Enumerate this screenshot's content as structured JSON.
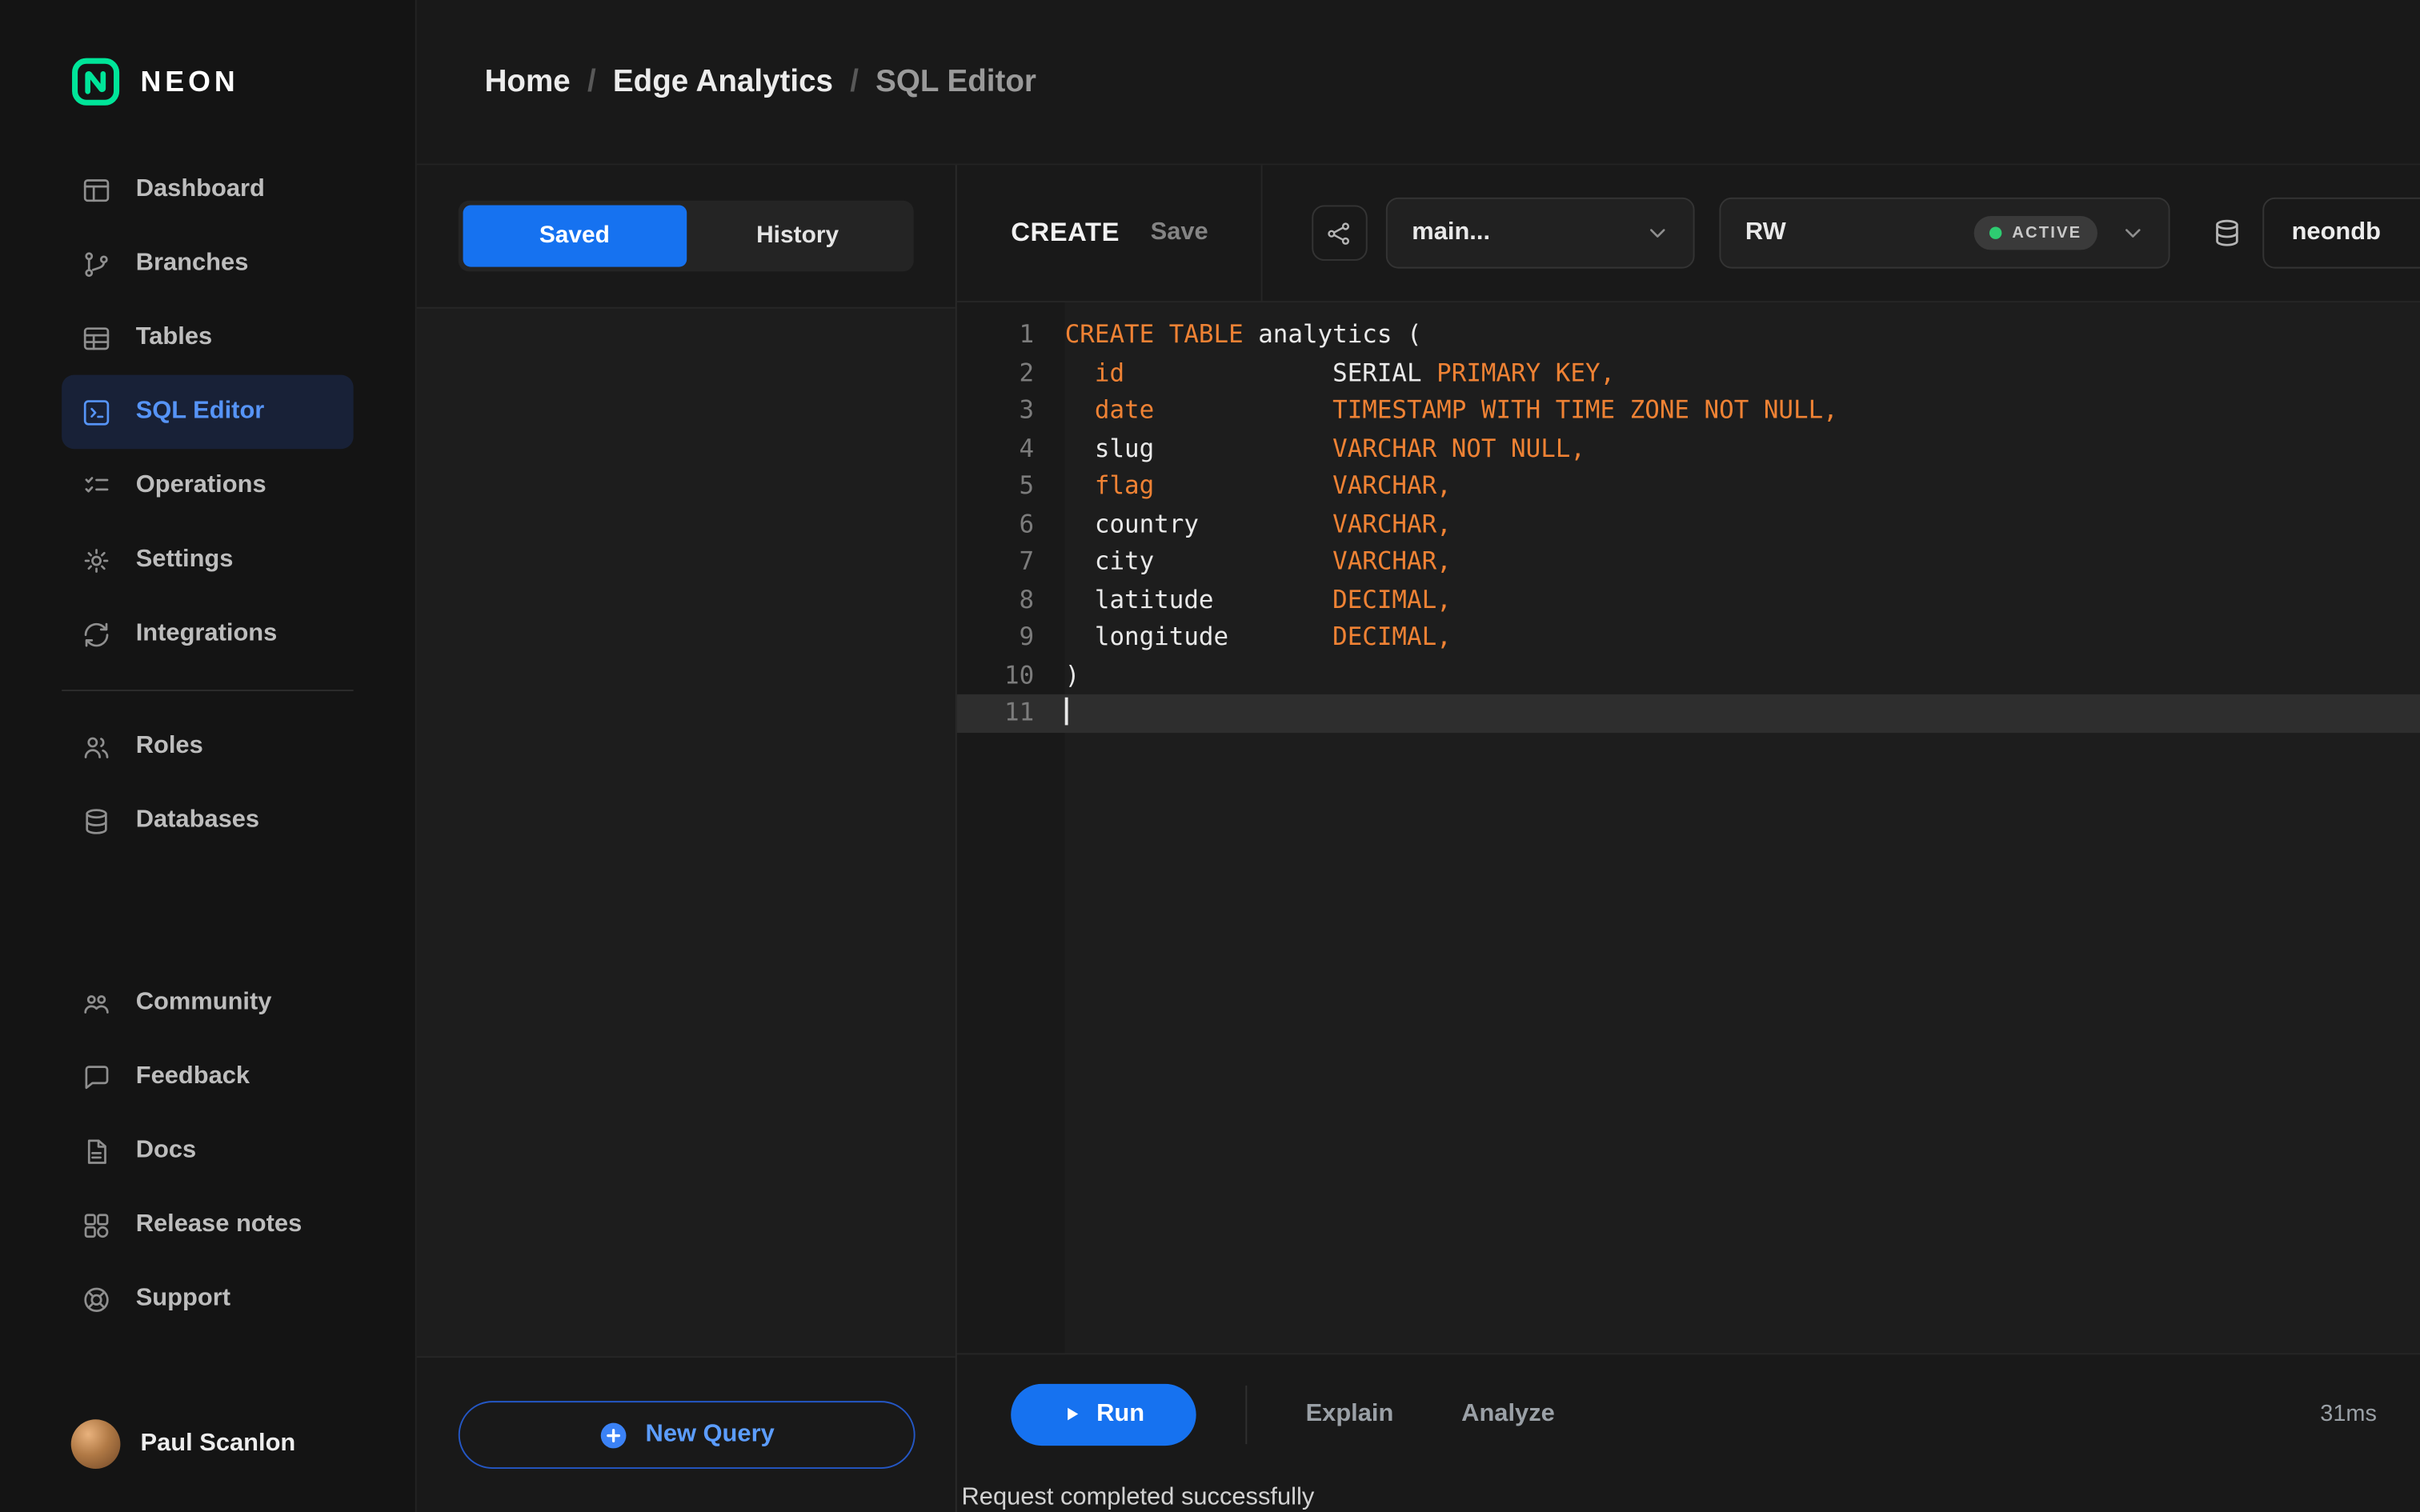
{
  "brand": {
    "name": "NEON"
  },
  "colors": {
    "accent_blue": "#1672f0",
    "accent_text": "#5694f7",
    "link_blue": "#5c9dff",
    "keyword_orange": "#ef8234",
    "neon_green": "#00e599",
    "status_green": "#2ecc71"
  },
  "breadcrumb": {
    "separator": "/",
    "items": [
      "Home",
      "Edge Analytics",
      "SQL Editor"
    ]
  },
  "sidebar": {
    "sections": [
      {
        "items": [
          {
            "icon": "dashboard-icon",
            "label": "Dashboard"
          },
          {
            "icon": "branches-icon",
            "label": "Branches"
          },
          {
            "icon": "tables-icon",
            "label": "Tables"
          },
          {
            "icon": "sql-editor-icon",
            "label": "SQL Editor",
            "active": true
          },
          {
            "icon": "operations-icon",
            "label": "Operations"
          },
          {
            "icon": "settings-icon",
            "label": "Settings"
          },
          {
            "icon": "integrations-icon",
            "label": "Integrations"
          }
        ]
      },
      {
        "items": [
          {
            "icon": "roles-icon",
            "label": "Roles"
          },
          {
            "icon": "databases-icon",
            "label": "Databases"
          }
        ]
      },
      {
        "items": [
          {
            "icon": "community-icon",
            "label": "Community"
          },
          {
            "icon": "feedback-icon",
            "label": "Feedback"
          },
          {
            "icon": "docs-icon",
            "label": "Docs"
          },
          {
            "icon": "release-notes-icon",
            "label": "Release notes"
          },
          {
            "icon": "support-icon",
            "label": "Support"
          }
        ]
      }
    ],
    "user": {
      "name": "Paul Scanlon"
    }
  },
  "queries_panel": {
    "tabs": [
      {
        "label": "Saved",
        "active": true
      },
      {
        "label": "History",
        "active": false
      }
    ],
    "new_query_label": "New Query"
  },
  "editor": {
    "tab_title": "CREATE",
    "save_label": "Save",
    "branch_select": {
      "value": "main..."
    },
    "endpoint_select": {
      "value": "RW",
      "status": "ACTIVE"
    },
    "database": {
      "value": "neondb"
    },
    "code": {
      "lines": [
        {
          "tokens": [
            {
              "t": "CREATE TABLE",
              "k": 1
            },
            {
              "t": " analytics (",
              "k": 0
            }
          ]
        },
        {
          "tokens": [
            {
              "t": "  ",
              "k": 0
            },
            {
              "t": "id",
              "k": 1
            },
            {
              "t": "              ",
              "k": 0
            },
            {
              "t": "SERIAL ",
              "k": 0
            },
            {
              "t": "PRIMARY KEY,",
              "k": 1
            }
          ]
        },
        {
          "tokens": [
            {
              "t": "  ",
              "k": 0
            },
            {
              "t": "date",
              "k": 1
            },
            {
              "t": "            ",
              "k": 0
            },
            {
              "t": "TIMESTAMP WITH TIME ZONE NOT NULL,",
              "k": 1
            }
          ]
        },
        {
          "tokens": [
            {
              "t": "  slug            ",
              "k": 0
            },
            {
              "t": "VARCHAR NOT NULL,",
              "k": 1
            }
          ]
        },
        {
          "tokens": [
            {
              "t": "  ",
              "k": 0
            },
            {
              "t": "flag",
              "k": 1
            },
            {
              "t": "            ",
              "k": 0
            },
            {
              "t": "VARCHAR,",
              "k": 1
            }
          ]
        },
        {
          "tokens": [
            {
              "t": "  country         ",
              "k": 0
            },
            {
              "t": "VARCHAR,",
              "k": 1
            }
          ]
        },
        {
          "tokens": [
            {
              "t": "  city            ",
              "k": 0
            },
            {
              "t": "VARCHAR,",
              "k": 1
            }
          ]
        },
        {
          "tokens": [
            {
              "t": "  latitude        ",
              "k": 0
            },
            {
              "t": "DECIMAL,",
              "k": 1
            }
          ]
        },
        {
          "tokens": [
            {
              "t": "  longitude       ",
              "k": 0
            },
            {
              "t": "DECIMAL,",
              "k": 1
            }
          ]
        },
        {
          "tokens": [
            {
              "t": ")",
              "k": 0
            }
          ]
        },
        {
          "tokens": [],
          "cursor": true
        }
      ]
    },
    "footer": {
      "run_label": "Run",
      "explain_label": "Explain",
      "analyze_label": "Analyze",
      "duration": "31ms"
    },
    "status_message": "Request completed successfully"
  }
}
